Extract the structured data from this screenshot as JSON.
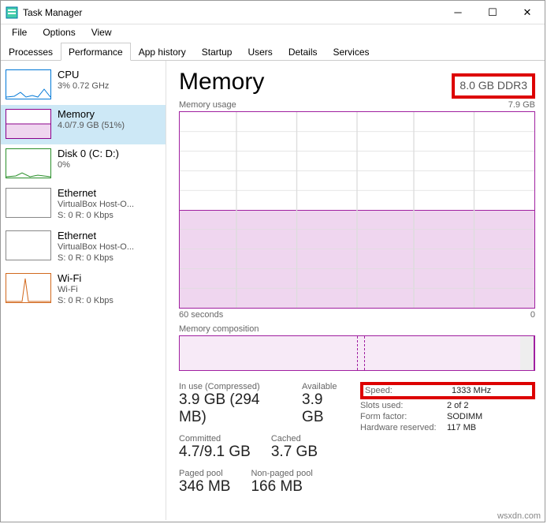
{
  "window": {
    "title": "Task Manager"
  },
  "menu": {
    "file": "File",
    "options": "Options",
    "view": "View"
  },
  "tabs": {
    "processes": "Processes",
    "performance": "Performance",
    "app_history": "App history",
    "startup": "Startup",
    "users": "Users",
    "details": "Details",
    "services": "Services"
  },
  "sidebar": {
    "cpu": {
      "title": "CPU",
      "sub": "3% 0.72 GHz"
    },
    "memory": {
      "title": "Memory",
      "sub": "4.0/7.9 GB (51%)"
    },
    "disk": {
      "title": "Disk 0 (C: D:)",
      "sub": "0%"
    },
    "eth1": {
      "title": "Ethernet",
      "sub1": "VirtualBox Host-O...",
      "sub2": "S: 0 R: 0 Kbps"
    },
    "eth2": {
      "title": "Ethernet",
      "sub1": "VirtualBox Host-O...",
      "sub2": "S: 0 R: 0 Kbps"
    },
    "wifi": {
      "title": "Wi-Fi",
      "sub1": "Wi-Fi",
      "sub2": "S: 0 R: 0 Kbps"
    }
  },
  "main": {
    "heading": "Memory",
    "capacity": "8.0 GB DDR3",
    "usage_label": "Memory usage",
    "usage_max": "7.9 GB",
    "axis_left": "60 seconds",
    "axis_right": "0",
    "comp_label": "Memory composition",
    "stats": {
      "inuse_lbl": "In use (Compressed)",
      "inuse_val": "3.9 GB (294 MB)",
      "avail_lbl": "Available",
      "avail_val": "3.9 GB",
      "commit_lbl": "Committed",
      "commit_val": "4.7/9.1 GB",
      "cached_lbl": "Cached",
      "cached_val": "3.7 GB",
      "paged_lbl": "Paged pool",
      "paged_val": "346 MB",
      "nonpaged_lbl": "Non-paged pool",
      "nonpaged_val": "166 MB"
    },
    "kv": {
      "speed_k": "Speed:",
      "speed_v": "1333 MHz",
      "slots_k": "Slots used:",
      "slots_v": "2 of 2",
      "form_k": "Form factor:",
      "form_v": "SODIMM",
      "hw_k": "Hardware reserved:",
      "hw_v": "117 MB"
    }
  },
  "watermark": "wsxdn.com",
  "chart_data": {
    "type": "area",
    "title": "Memory usage",
    "ylabel": "GB",
    "ylim": [
      0,
      7.9
    ],
    "xlabel": "seconds ago",
    "xlim": [
      60,
      0
    ],
    "series": [
      {
        "name": "In use",
        "approx_constant_value": 4.0
      }
    ]
  }
}
